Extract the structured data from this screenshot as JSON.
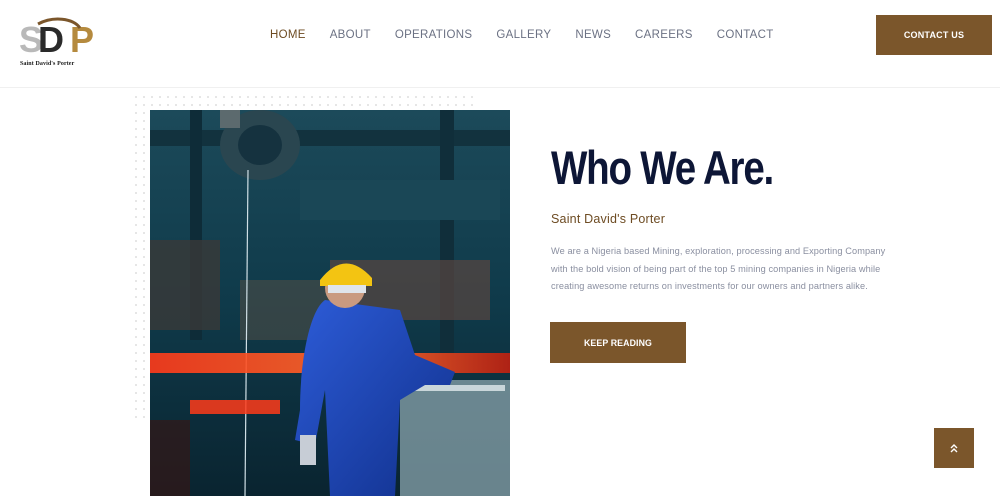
{
  "brand": {
    "logo_text": "SDP",
    "tagline": "Saint David's Porter",
    "colors": {
      "brand": "#7b562b",
      "gold": "#b58a3e",
      "navy": "#0d1636",
      "nav_text": "#6b7183"
    }
  },
  "nav": {
    "items": [
      {
        "label": "HOME",
        "active": true
      },
      {
        "label": "ABOUT"
      },
      {
        "label": "OPERATIONS"
      },
      {
        "label": "GALLERY"
      },
      {
        "label": "NEWS"
      },
      {
        "label": "CAREERS"
      },
      {
        "label": "CONTACT"
      }
    ],
    "cta_label": "CONTACT US"
  },
  "about": {
    "heading": "Who We Are.",
    "subheading": "Saint David's Porter",
    "body": "We are a Nigeria based Mining, exploration, processing and Exporting Company with the bold vision of being part of the top 5 mining companies in Nigeria while creating awesome returns on investments for our owners and partners alike.",
    "button_label": "KEEP READING"
  },
  "scroll_top": {
    "icon": "double-chevron-up-icon"
  }
}
